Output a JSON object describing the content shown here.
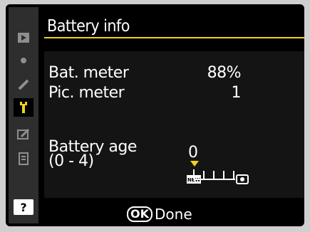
{
  "title": "Battery info",
  "sidebar": {
    "icons": [
      "playback-menu-icon",
      "shooting-menu-icon",
      "custom-settings-icon",
      "setup-menu-icon",
      "retouch-menu-icon",
      "my-menu-icon"
    ],
    "help_label": "?"
  },
  "rows": {
    "bat_meter": {
      "label": "Bat. meter",
      "value": "88%"
    },
    "pic_meter": {
      "label": "Pic. meter",
      "value": "1"
    },
    "battery_age": {
      "label_line1": "Battery age",
      "label_line2": "(0 - 4)",
      "value": "0"
    }
  },
  "gauge": {
    "new_label": "NEW",
    "level": 0,
    "max_level": 4
  },
  "footer": {
    "ok_label": "OK",
    "done_label": "Done"
  },
  "colors": {
    "accent": "#f1d21a",
    "sidebar_bg": "#2e2e2e",
    "content_bg": "#141414"
  }
}
